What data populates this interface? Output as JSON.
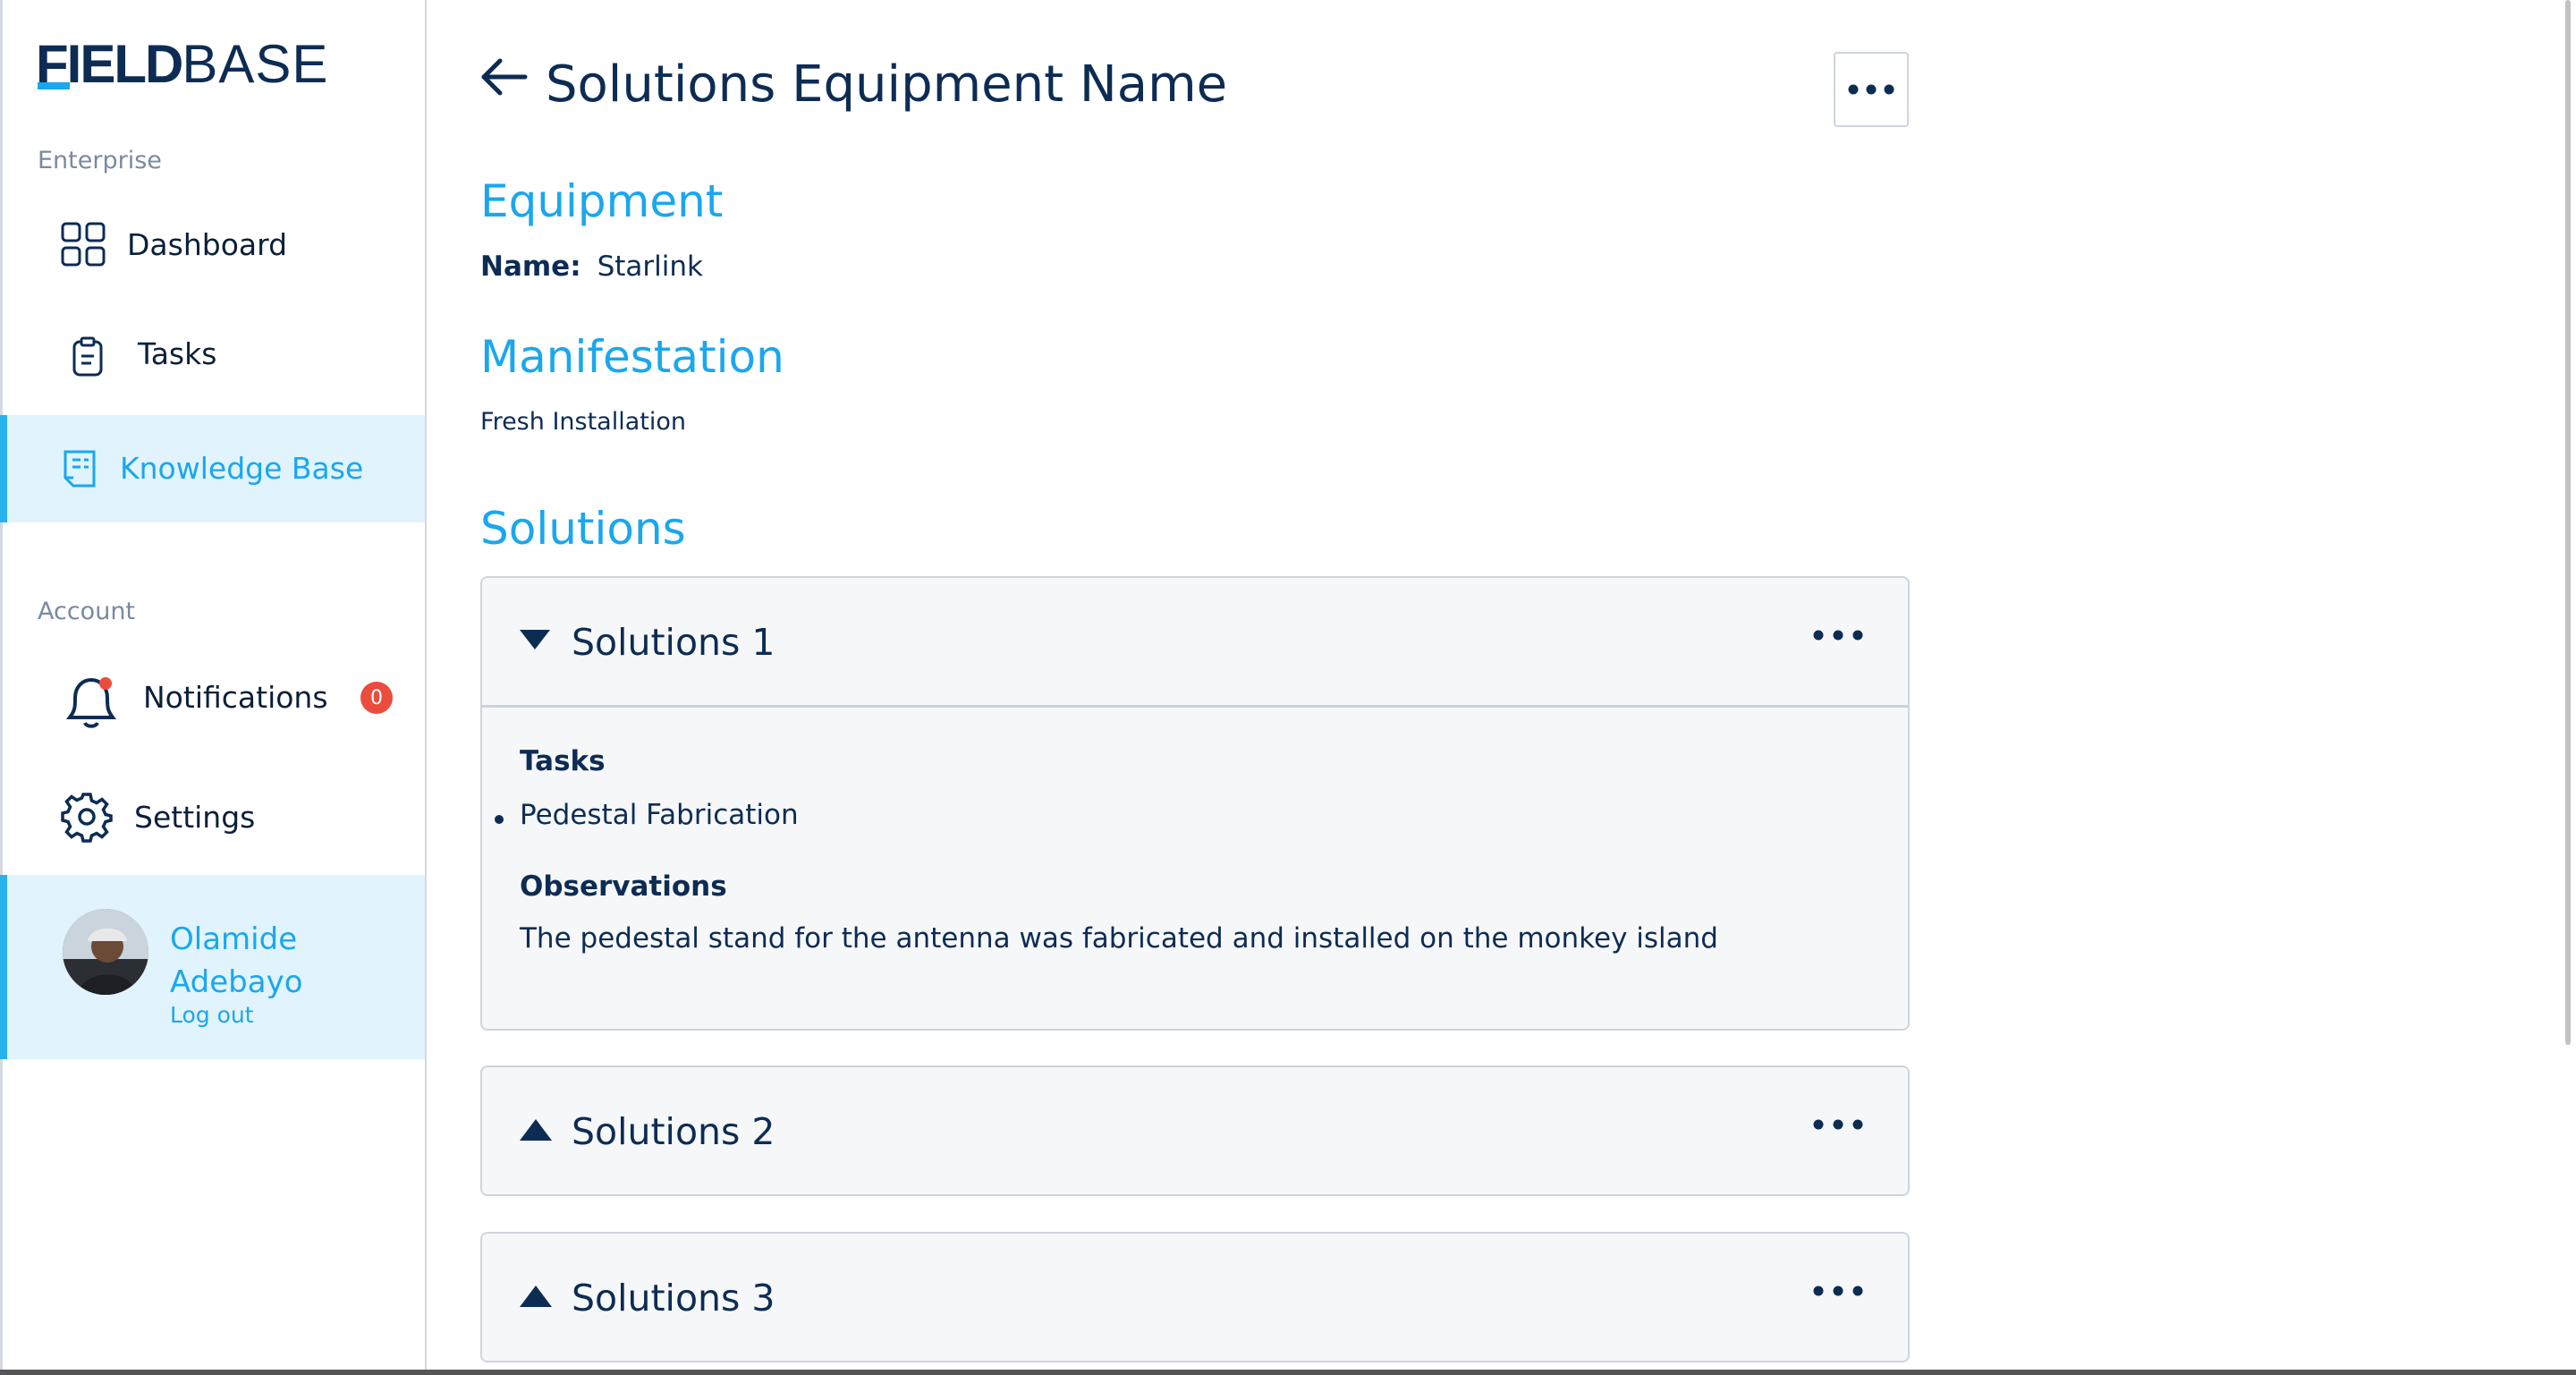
{
  "brand": {
    "logo_part1": "FIELD",
    "logo_part2": "BASE"
  },
  "sidebar": {
    "enterprise_label": "Enterprise",
    "account_label": "Account",
    "items": [
      {
        "label": "Dashboard",
        "icon": "dashboard-grid-icon"
      },
      {
        "label": "Tasks",
        "icon": "clipboard-icon"
      },
      {
        "label": "Knowledge Base",
        "icon": "document-icon",
        "active": true
      }
    ],
    "account_items": [
      {
        "label": "Notifications",
        "icon": "bell-icon",
        "badge": "0"
      },
      {
        "label": "Settings",
        "icon": "gear-icon"
      }
    ],
    "user": {
      "name": "Olamide Adebayo",
      "logout": "Log out"
    }
  },
  "header": {
    "title": "Solutions Equipment Name",
    "menu_icon": "more-horizontal-icon"
  },
  "equipment": {
    "heading": "Equipment",
    "name_key": "Name:",
    "name_value": "Starlink"
  },
  "manifestation": {
    "heading": "Manifestation",
    "text": "Fresh Installation"
  },
  "solutions": {
    "heading": "Solutions",
    "items": [
      {
        "title": "Solutions 1",
        "expanded": true,
        "tasks_label": "Tasks",
        "tasks": [
          "Pedestal Fabrication"
        ],
        "observations_label": "Observations",
        "observations": "The pedestal stand for the antenna was fabricated and installed on the monkey island"
      },
      {
        "title": "Solutions 2",
        "expanded": false
      },
      {
        "title": "Solutions 3",
        "expanded": false
      }
    ]
  },
  "colors": {
    "accent": "#1aa7ee",
    "navy": "#0d2c54",
    "badge": "#ea4c3d",
    "active_bg": "#e1f3fc"
  }
}
